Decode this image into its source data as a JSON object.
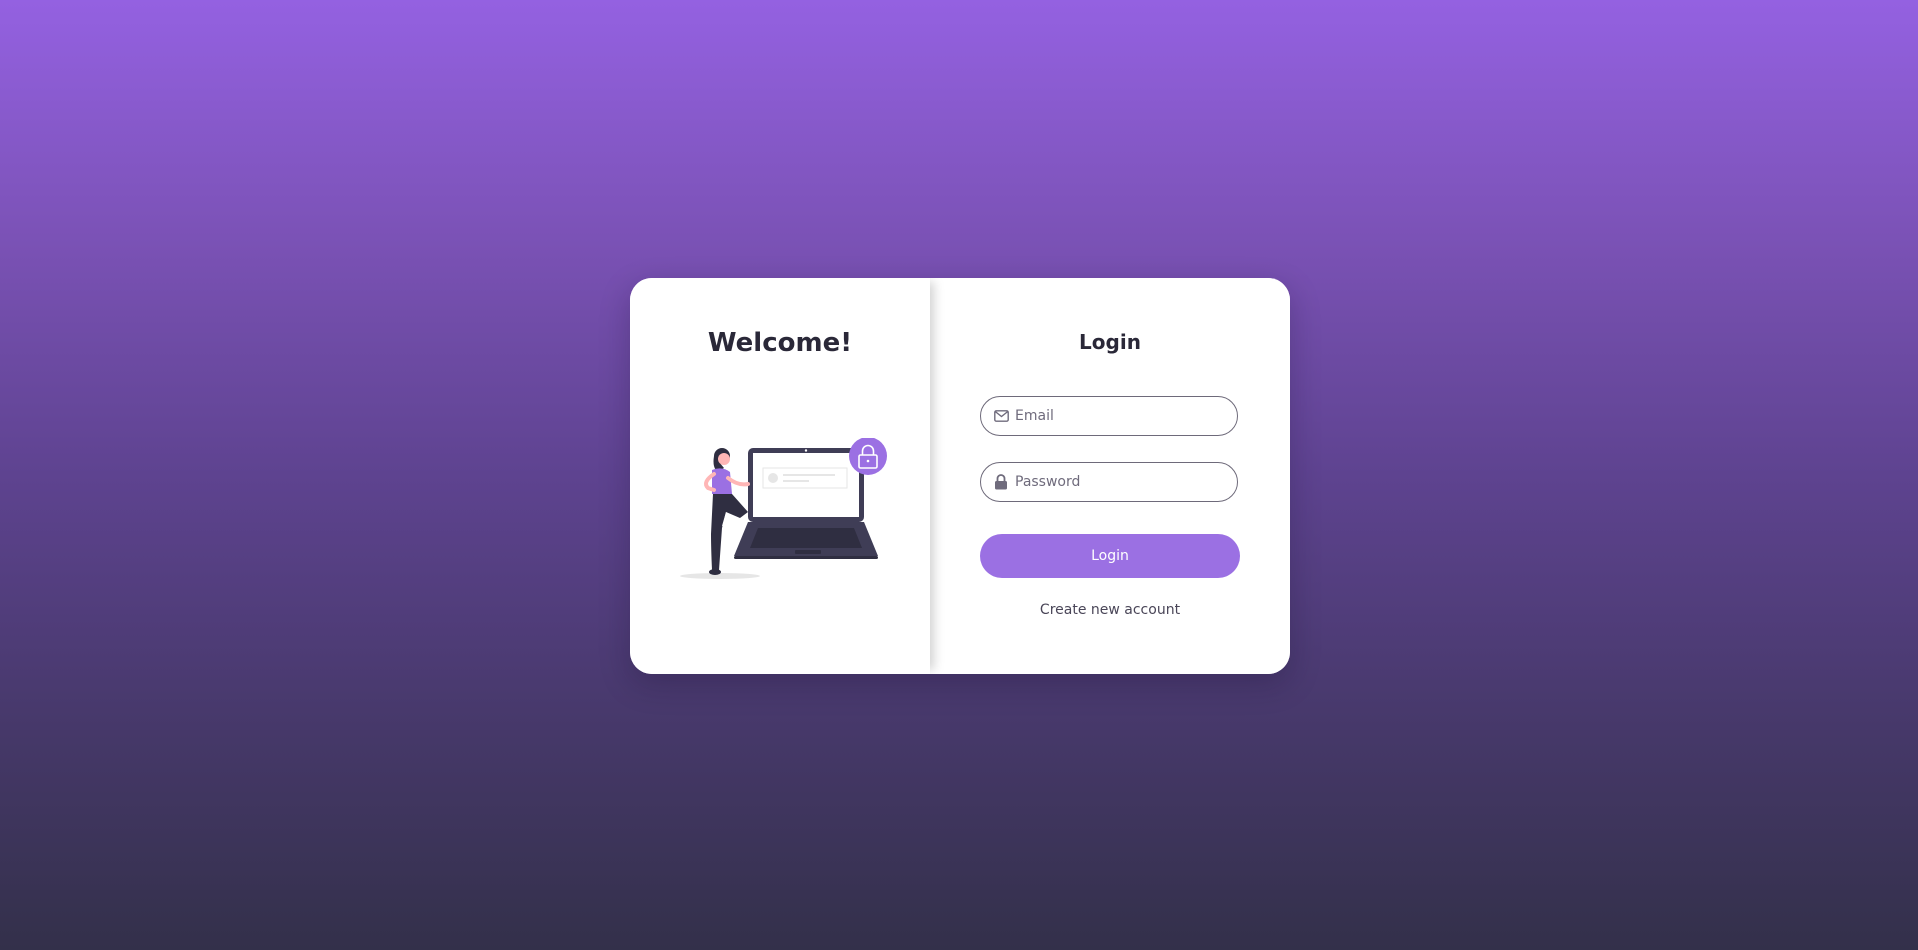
{
  "welcome": {
    "title": "Welcome!"
  },
  "login": {
    "title": "Login",
    "email": {
      "placeholder": "Email",
      "value": "",
      "icon": "envelope-icon"
    },
    "password": {
      "placeholder": "Password",
      "value": "",
      "icon": "lock-icon"
    },
    "button_label": "Login",
    "create_account_link": "Create new account"
  },
  "colors": {
    "accent": "#9b70e3",
    "card_bg": "#ffffff",
    "text_dark": "#2a2838",
    "gradient_top": "#9461e1",
    "gradient_bottom": "#33304a"
  }
}
